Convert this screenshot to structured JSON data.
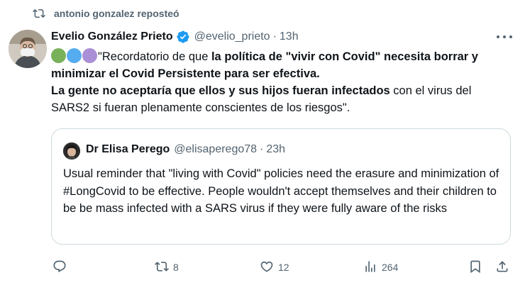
{
  "repost": {
    "text": "antonio gonzalez reposteó"
  },
  "tweet": {
    "author_name": "Evelio González Prieto",
    "handle": "@evelio_prieto",
    "separator": "·",
    "time": "13h",
    "dots": [
      "#78b159",
      "#55acee",
      "#aa8ed6"
    ],
    "text_parts": {
      "p1": "\"Recordatorio de que ",
      "p2": "la política de \"vivir con Covid\" necesita borrar y minimizar el Covid Persistente  para ser efectiva.",
      "p3": "La gente no aceptaría que ellos y sus hijos fueran infectados",
      "p4": " con el virus del SARS2 si fueran plenamente conscientes de los riesgos\"."
    }
  },
  "quote": {
    "author_name": "Dr Elisa Perego",
    "handle": "@elisaperego78",
    "separator": "·",
    "time": "23h",
    "text": "Usual reminder that \"living with Covid\" policies need the erasure and minimization of #LongCovid to be effective. People wouldn't accept themselves and their children to be be mass infected with a SARS virus if they were fully aware of the risks"
  },
  "actions": {
    "reposts": "8",
    "likes": "12",
    "views": "264"
  },
  "colors": {
    "text_primary": "#0f1419",
    "text_secondary": "#536471",
    "verified_blue": "#1d9bf0",
    "border": "#cfd9de"
  },
  "icons": [
    "repost-icon",
    "verified-badge-icon",
    "more-icon",
    "reply-icon",
    "retweet-icon",
    "like-icon",
    "views-icon",
    "bookmark-icon",
    "share-icon"
  ]
}
